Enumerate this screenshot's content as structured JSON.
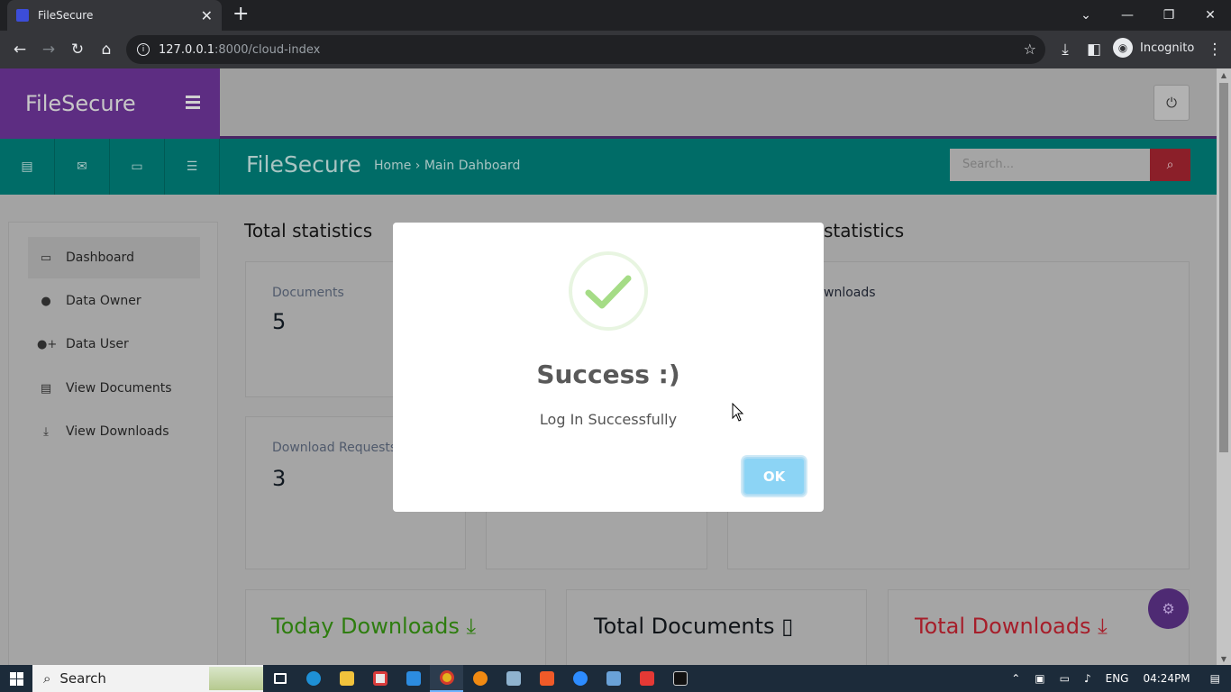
{
  "browser": {
    "tab_title": "FileSecure",
    "url_host": "127.0.0.1",
    "url_rest": ":8000/cloud-index",
    "incognito_label": "Incognito"
  },
  "app": {
    "brand": "FileSecure",
    "header_logo": "FileSecure",
    "breadcrumb": "Home › Main Dahboard",
    "search_placeholder": "Search..."
  },
  "sidebar": {
    "items": [
      {
        "label": "Dashboard",
        "icon": "monitor-icon"
      },
      {
        "label": "Data Owner",
        "icon": "user-icon"
      },
      {
        "label": "Data User",
        "icon": "user-plus-icon"
      },
      {
        "label": "View Documents",
        "icon": "document-icon"
      },
      {
        "label": "View Downloads",
        "icon": "download-tray-icon"
      }
    ]
  },
  "stats": {
    "left_title": "Total statistics",
    "right_title": "statistics",
    "documents_label": "Documents",
    "documents_value": "5",
    "download_requests_label": "Download Requests",
    "download_requests_value": "3",
    "downloads_label": "wnloads"
  },
  "bottom_cards": {
    "today": "Today Downloads",
    "documents": "Total Documents",
    "downloads": "Total Downloads"
  },
  "modal": {
    "title": "Success :)",
    "message": "Log In Successfully",
    "ok_label": "OK"
  },
  "taskbar": {
    "search_label": "Search",
    "language": "ENG",
    "time": "04:24PM"
  },
  "colors": {
    "brand_purple": "#5d2d82",
    "teal": "#006c67",
    "green": "#2e7d0f",
    "red": "#a61e2a",
    "ok_blue": "#8cd4f5"
  }
}
